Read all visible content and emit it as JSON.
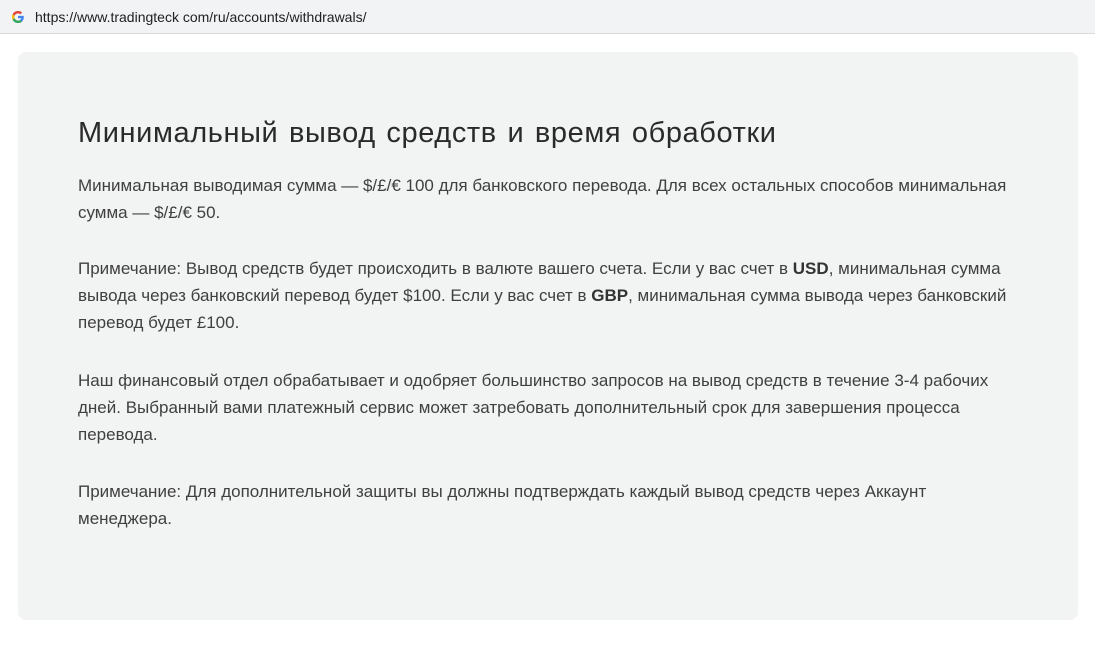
{
  "browser": {
    "favicon": "google-g-icon",
    "url": "https://www.tradingteck com/ru/accounts/withdrawals/"
  },
  "content": {
    "title": "Минимальный вывод средств и время обработки",
    "paragraph1": "Минимальная выводимая сумма — $/£/€ 100 для банковского перевода. Для всех остальных способов минимальная сумма — $/£/€ 50.",
    "paragraph2": {
      "part1": "Примечание: Вывод средств будет происходить в валюте вашего счета. Если у вас счет в ",
      "bold1": "USD",
      "part2": ", минимальная сумма вывода через банковский перевод будет $100. Если у вас счет в ",
      "bold2": "GBP",
      "part3": ", минимальная сумма вывода через банковский перевод будет £100."
    },
    "paragraph3": "Наш финансовый отдел обрабатывает и одобряет большинство запросов на вывод средств в течение 3-4 рабочих дней. Выбранный вами платежный сервис может затребовать дополнительный срок для завершения процесса перевода.",
    "paragraph4": "Примечание: Для дополнительной защиты вы должны подтверждать каждый вывод средств через Аккаунт менеджера."
  },
  "colors": {
    "card_background": "#f2f3f3",
    "text": "#404040",
    "title": "#2a2a2a"
  }
}
